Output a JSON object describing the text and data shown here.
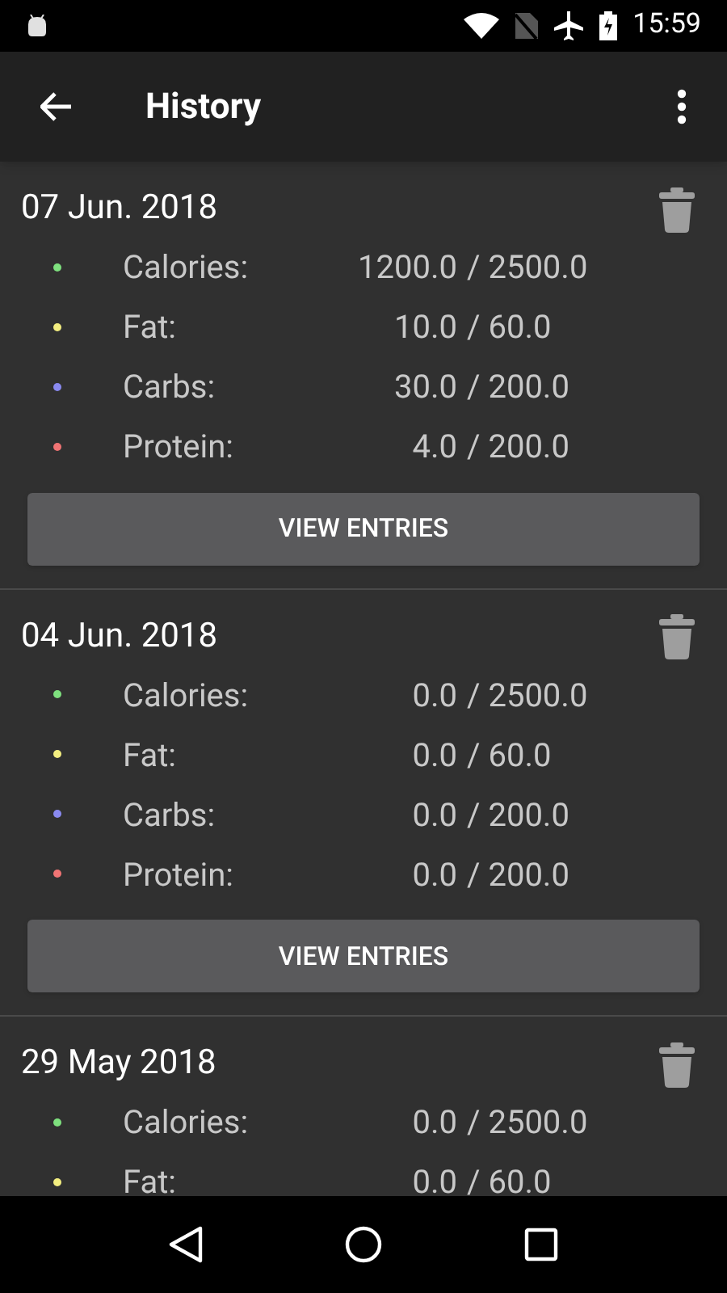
{
  "status_bar": {
    "time": "15:59"
  },
  "toolbar": {
    "title": "History"
  },
  "days": [
    {
      "date": "07 Jun. 2018",
      "button": "VIEW ENTRIES",
      "nutrients": [
        {
          "label": "Calories:",
          "amount": "1200.0",
          "limit": "/ 2500.0",
          "color": "#7ee07e"
        },
        {
          "label": "Fat:",
          "amount": "10.0",
          "limit": "/ 60.0",
          "color": "#f3ee80"
        },
        {
          "label": "Carbs:",
          "amount": "30.0",
          "limit": "/ 200.0",
          "color": "#8a8af0"
        },
        {
          "label": "Protein:",
          "amount": "4.0",
          "limit": "/ 200.0",
          "color": "#f07474"
        }
      ]
    },
    {
      "date": "04 Jun. 2018",
      "button": "VIEW ENTRIES",
      "nutrients": [
        {
          "label": "Calories:",
          "amount": "0.0",
          "limit": "/ 2500.0",
          "color": "#7ee07e"
        },
        {
          "label": "Fat:",
          "amount": "0.0",
          "limit": "/ 60.0",
          "color": "#f3ee80"
        },
        {
          "label": "Carbs:",
          "amount": "0.0",
          "limit": "/ 200.0",
          "color": "#8a8af0"
        },
        {
          "label": "Protein:",
          "amount": "0.0",
          "limit": "/ 200.0",
          "color": "#f07474"
        }
      ]
    },
    {
      "date": "29 May 2018",
      "nutrients": [
        {
          "label": "Calories:",
          "amount": "0.0",
          "limit": "/ 2500.0",
          "color": "#7ee07e"
        },
        {
          "label": "Fat:",
          "amount": "0.0",
          "limit": "/ 60.0",
          "color": "#f3ee80"
        }
      ]
    }
  ]
}
